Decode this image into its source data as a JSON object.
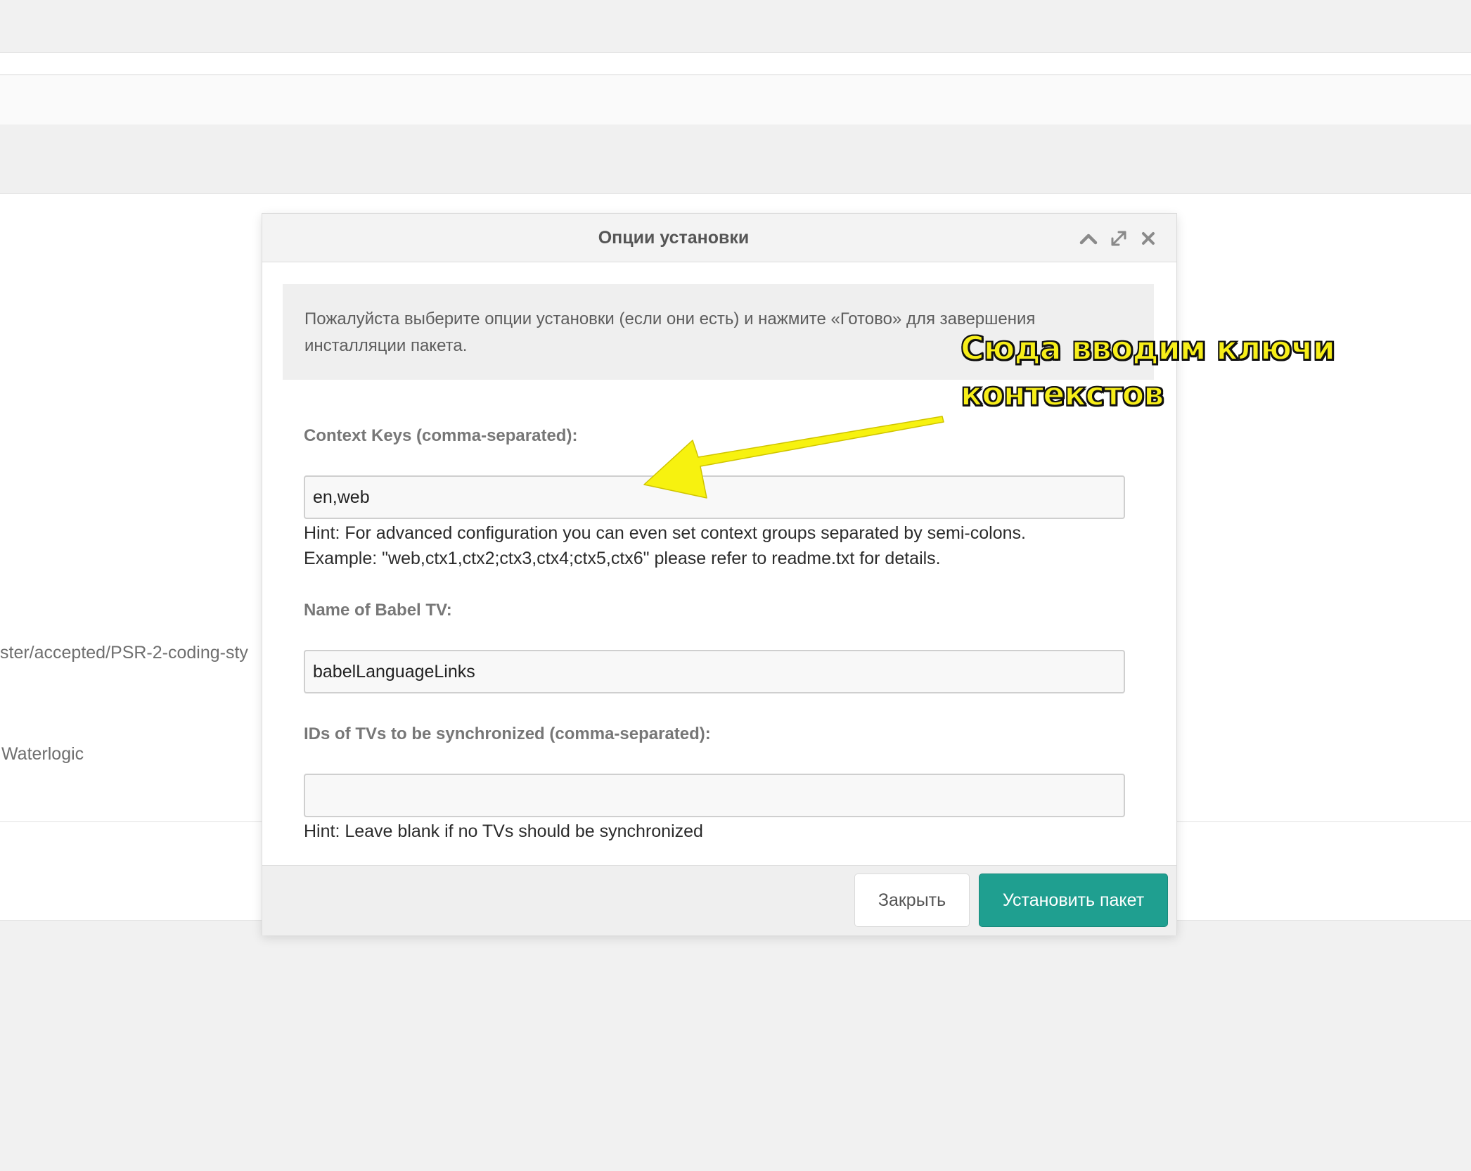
{
  "background": {
    "url_fragment": "ster/accepted/PSR-2-coding-sty",
    "vendor": "Waterlogic"
  },
  "modal": {
    "title": "Опции установки",
    "intro": "Пожалуйста выберите опции установки (если они есть) и нажмите «Готово» для завершения инсталляции пакета.",
    "fields": {
      "context_keys": {
        "label": "Context Keys (comma-separated):",
        "value": "en,web",
        "hint_line1": "Hint: For advanced configuration you can even set context groups separated by semi-colons.",
        "hint_line2": "Example: \"web,ctx1,ctx2;ctx3,ctx4;ctx5,ctx6\" please refer to readme.txt for details."
      },
      "babel_tv": {
        "label": "Name of Babel TV:",
        "value": "babelLanguageLinks"
      },
      "sync_tvs": {
        "label": "IDs of TVs to be synchronized (comma-separated):",
        "value": "",
        "hint": "Hint: Leave blank if no TVs should be synchronized"
      }
    },
    "buttons": {
      "close": "Закрыть",
      "install": "Установить пакет"
    },
    "header_icons": [
      "chevron-up-icon",
      "expand-icon",
      "close-icon"
    ]
  },
  "annotation": {
    "text": "Сюда вводим ключи\nконтекстов",
    "color": "#f7ee19"
  },
  "colors": {
    "primary_button": "#1f9f90",
    "annotation_yellow": "#f7ee19"
  }
}
